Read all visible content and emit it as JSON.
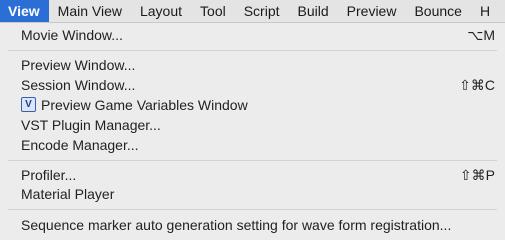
{
  "menubar": {
    "items": [
      "View",
      "Main View",
      "Layout",
      "Tool",
      "Script",
      "Build",
      "Preview",
      "Bounce",
      "H"
    ]
  },
  "menu": {
    "movie_window": {
      "label": "Movie Window...",
      "shortcut": "⌥M"
    },
    "preview_window": {
      "label": "Preview Window..."
    },
    "session_window": {
      "label": "Session Window...",
      "shortcut": "⇧⌘C"
    },
    "preview_game_variables": {
      "label": "Preview Game Variables Window",
      "badge": "V"
    },
    "vst_plugin_manager": {
      "label": "VST Plugin Manager..."
    },
    "encode_manager": {
      "label": "Encode Manager..."
    },
    "profiler": {
      "label": "Profiler...",
      "shortcut": "⇧⌘P"
    },
    "material_player": {
      "label": "Material Player"
    },
    "sequence_marker": {
      "label": "Sequence marker auto generation setting for wave form registration..."
    }
  },
  "colors": {
    "active_menu_bg": "#2b6fd6",
    "menu_bg": "#ececec"
  }
}
